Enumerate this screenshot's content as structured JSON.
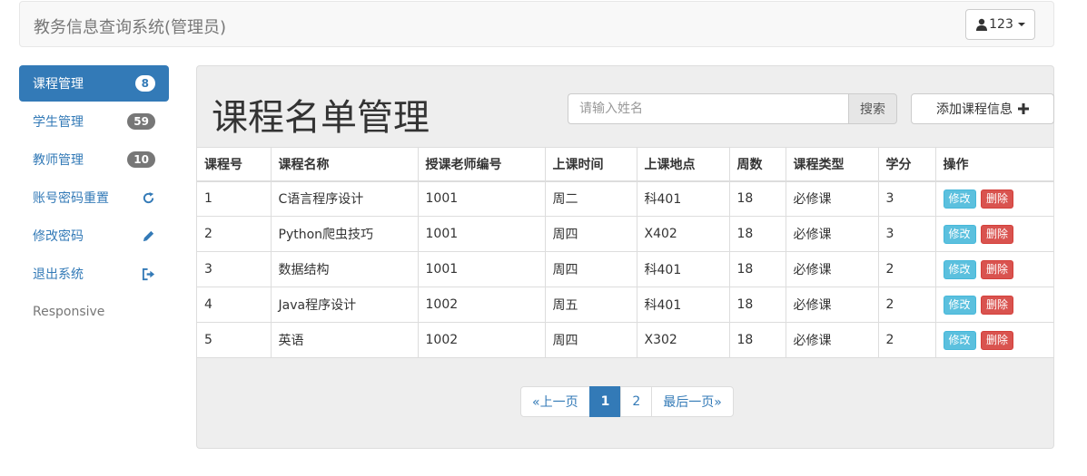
{
  "header": {
    "brand": "教务信息查询系统(管理员)",
    "user_label": "123"
  },
  "sidebar": {
    "items": [
      {
        "label": "课程管理",
        "badge": "8"
      },
      {
        "label": "学生管理",
        "badge": "59"
      },
      {
        "label": "教师管理",
        "badge": "10"
      },
      {
        "label": "账号密码重置",
        "icon": "refresh-icon"
      },
      {
        "label": "修改密码",
        "icon": "pencil-icon"
      },
      {
        "label": "退出系统",
        "icon": "logout-icon"
      },
      {
        "label": "Responsive"
      }
    ]
  },
  "main": {
    "title": "课程名单管理",
    "search": {
      "placeholder": "请输入姓名",
      "button": "搜索"
    },
    "add_button": "添加课程信息",
    "table": {
      "headers": [
        "课程号",
        "课程名称",
        "授课老师编号",
        "上课时间",
        "上课地点",
        "周数",
        "课程类型",
        "学分",
        "操作"
      ],
      "rows": [
        [
          "1",
          "C语言程序设计",
          "1001",
          "周二",
          "科401",
          "18",
          "必修课",
          "3"
        ],
        [
          "2",
          "Python爬虫技巧",
          "1001",
          "周四",
          "X402",
          "18",
          "必修课",
          "3"
        ],
        [
          "3",
          "数据结构",
          "1001",
          "周四",
          "科401",
          "18",
          "必修课",
          "2"
        ],
        [
          "4",
          "Java程序设计",
          "1002",
          "周五",
          "科401",
          "18",
          "必修课",
          "2"
        ],
        [
          "5",
          "英语",
          "1002",
          "周四",
          "X302",
          "18",
          "必修课",
          "2"
        ]
      ],
      "edit_label": "修改",
      "delete_label": "删除"
    },
    "pagination": {
      "prev": "«上一页",
      "pages": [
        "1",
        "2"
      ],
      "current": "1",
      "last": "最后一页»"
    }
  },
  "colors": {
    "primary": "#337ab7",
    "info": "#5bc0de",
    "danger": "#d9534f"
  }
}
